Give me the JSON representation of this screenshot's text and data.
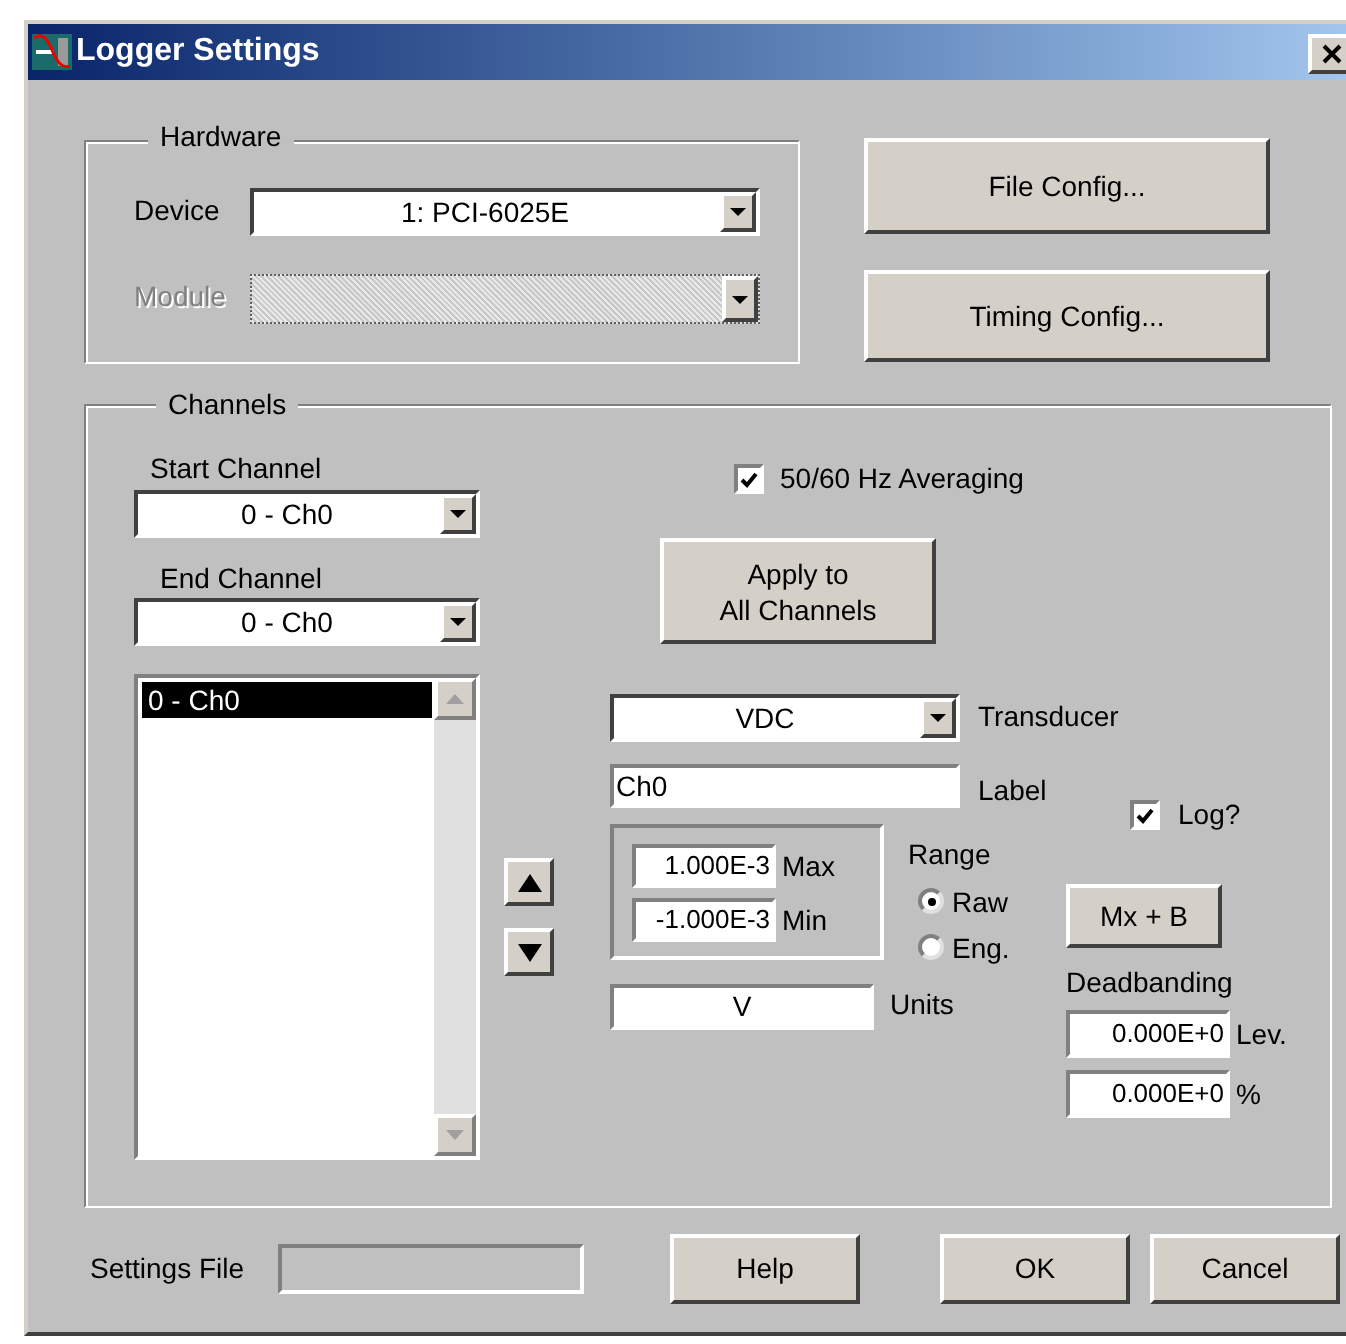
{
  "window": {
    "title": "Logger Settings"
  },
  "hardware": {
    "title": "Hardware",
    "device": {
      "label": "Device",
      "value": "1: PCI-6025E"
    },
    "module": {
      "label": "Module",
      "disabled": true
    }
  },
  "file_config_button": "File Config...",
  "timing_config_button": "Timing Config...",
  "channels": {
    "title": "Channels",
    "start_channel": {
      "label": "Start Channel",
      "value": "0 - Ch0"
    },
    "end_channel": {
      "label": "End Channel",
      "value": "0 - Ch0"
    },
    "channel_list": [
      {
        "label": "0 - Ch0",
        "selected": true
      }
    ],
    "averaging": {
      "label": "50/60 Hz Averaging",
      "checked": true
    },
    "apply_button": "Apply to\nAll Channels",
    "transducer": {
      "value": "VDC",
      "label": "Transducer"
    },
    "label_field": {
      "value": "Ch0",
      "label": "Label"
    },
    "log": {
      "label": "Log?",
      "checked": true
    },
    "max": {
      "value": "1.000E-3",
      "label": "Max"
    },
    "min": {
      "value": "-1.000E-3",
      "label": "Min"
    },
    "range": {
      "title": "Range",
      "options": [
        {
          "label": "Raw",
          "selected": true
        },
        {
          "label": "Eng.",
          "selected": false
        }
      ]
    },
    "mxb_button": "Mx + B",
    "units": {
      "value": "V",
      "label": "Units"
    },
    "deadbanding": {
      "title": "Deadbanding",
      "level": {
        "value": "0.000E+0",
        "label": "Lev."
      },
      "percent": {
        "value": "0.000E+0",
        "label": "%"
      }
    }
  },
  "footer": {
    "settings_file": {
      "label": "Settings File"
    },
    "buttons": [
      "Help",
      "OK",
      "Cancel"
    ]
  }
}
